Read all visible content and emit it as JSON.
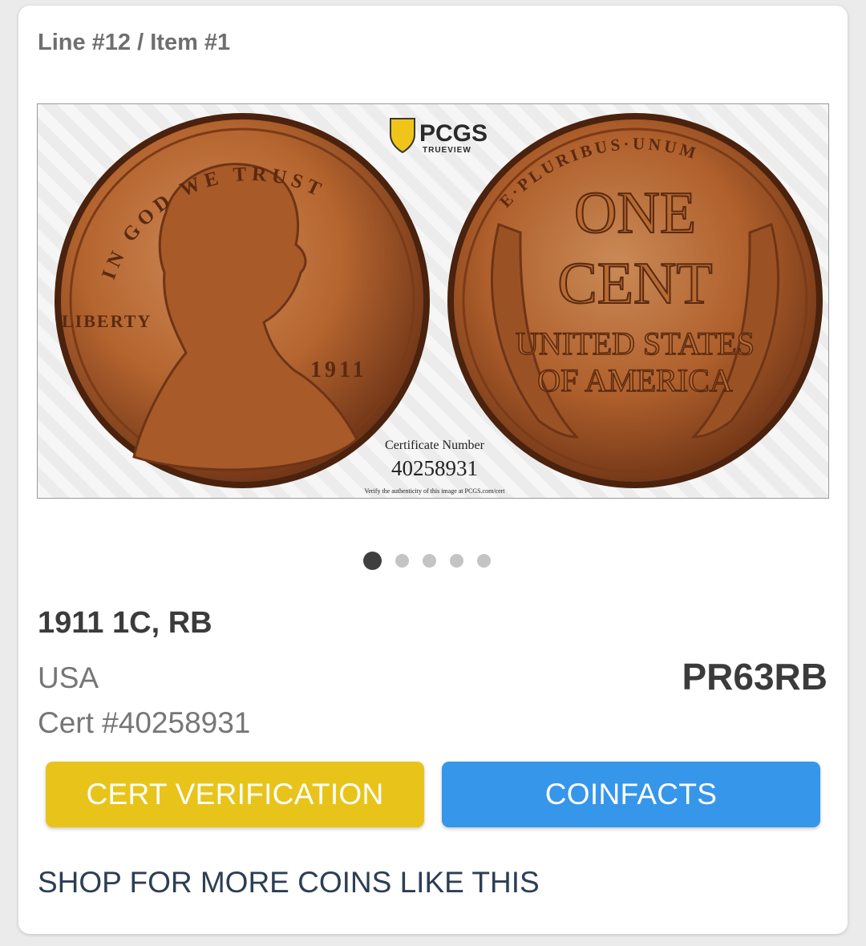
{
  "header": {
    "line_label": "Line #12 / Item #1"
  },
  "image": {
    "logo_text": "PCGS",
    "logo_subtext": "TRUEVIEW",
    "obverse": {
      "motto": "IN GOD WE TRUST",
      "liberty": "LIBERTY",
      "date": "1911"
    },
    "reverse": {
      "top_legend": "E·PLURIBUS·UNUM",
      "line1": "ONE",
      "line2": "CENT",
      "line3": "UNITED STATES",
      "line4": "OF AMERICA"
    },
    "cert_caption": "Certificate Number",
    "cert_number": "40258931",
    "verify_text": "Verify the authenticity of this image at PCGS.com/cert"
  },
  "carousel": {
    "count": 5,
    "active_index": 0
  },
  "details": {
    "title": "1911 1C, RB",
    "country": "USA",
    "grade": "PR63RB",
    "cert": "Cert #40258931"
  },
  "buttons": {
    "cert_verification": "CERT VERIFICATION",
    "coinfacts": "COINFACTS"
  },
  "shop_link": "SHOP FOR MORE COINS LIKE THIS",
  "colors": {
    "cert_button": "#e8c41a",
    "coinfacts_button": "#3596ea",
    "shop_link": "#2c3e55",
    "copper": "#b5652f"
  }
}
